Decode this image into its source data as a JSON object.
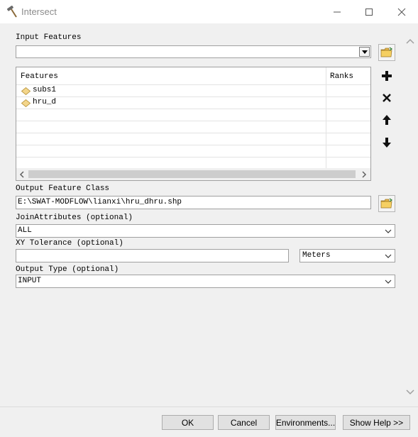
{
  "window": {
    "title": "Intersect",
    "icon": "hammer-icon"
  },
  "input_features": {
    "label": "Input Features",
    "value": ""
  },
  "features_grid": {
    "columns": [
      "Features",
      "Ranks"
    ],
    "rows": [
      {
        "name": "subs1",
        "rank": "",
        "icon": "polygon-layer-icon"
      },
      {
        "name": "hru_d",
        "rank": "",
        "icon": "polygon-layer-icon"
      }
    ]
  },
  "side_buttons": [
    "add-icon",
    "remove-icon",
    "move-up-icon",
    "move-down-icon"
  ],
  "output_feature_class": {
    "label": "Output Feature Class",
    "value": "E:\\SWAT-MODFLOW\\lianxi\\hru_dhru.shp"
  },
  "join_attributes": {
    "label": "JoinAttributes (optional)",
    "value": "ALL"
  },
  "xy_tolerance": {
    "label": "XY Tolerance (optional)",
    "value": "",
    "unit": "Meters"
  },
  "output_type": {
    "label": "Output Type (optional)",
    "value": "INPUT"
  },
  "footer": {
    "ok": "OK",
    "cancel": "Cancel",
    "environments": "Environments...",
    "show_help": "Show Help >>"
  }
}
